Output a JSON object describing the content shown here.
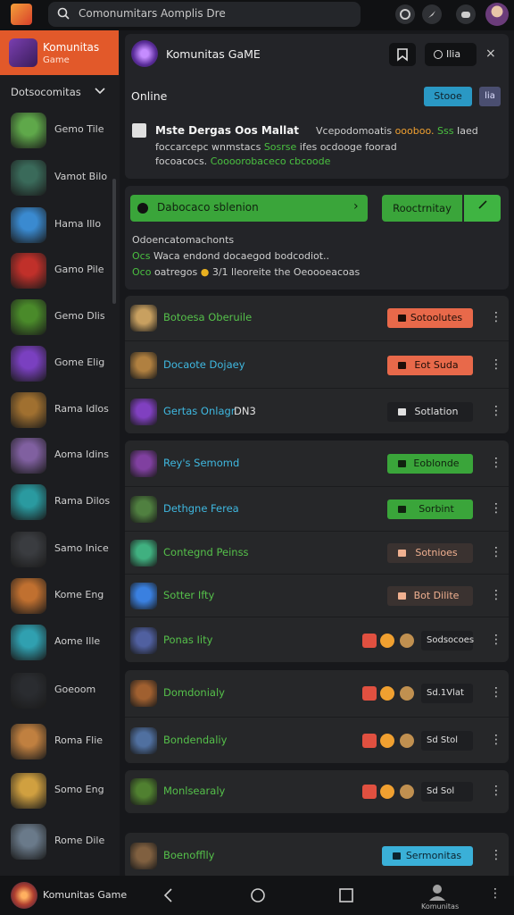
{
  "topbar": {
    "search_value": "Comonumitars Aomplis Dre",
    "icons": [
      "steam-icon",
      "compass-icon",
      "controller-icon"
    ]
  },
  "sidebar": {
    "active": {
      "title": "Komunitas",
      "subtitle": "Game"
    },
    "section_label": "Dotsocomitas",
    "items": [
      {
        "label": "Gemo Tile",
        "color": "#5fa84a"
      },
      {
        "label": "Vamot Bilo",
        "color": "#3a6a5a"
      },
      {
        "label": "Hama Illo",
        "color": "#3a8ad0"
      },
      {
        "label": "Gamo Pile",
        "color": "#c0302a"
      },
      {
        "label": "Gemo Dlis",
        "color": "#4a8a2a"
      },
      {
        "label": "Gome Elig",
        "color": "#7a40c0"
      },
      {
        "label": "Rama Idlos",
        "color": "#a07030"
      },
      {
        "label": "Aoma Idins",
        "color": "#8060a0"
      },
      {
        "label": "Rama Dilos",
        "color": "#2a9aa0"
      },
      {
        "label": "Samo Inice",
        "color": "#3a3c40"
      },
      {
        "label": "Kome Eng",
        "color": "#c07030"
      },
      {
        "label": "Aome Ille",
        "color": "#30a0b0"
      },
      {
        "label": "Goeoom",
        "color": "#2a2c30"
      },
      {
        "label": "Roma Flie",
        "color": "#c08040"
      },
      {
        "label": "Somo Eng",
        "color": "#d0a040"
      },
      {
        "label": "Rome Dile",
        "color": "#6a7a8a"
      }
    ]
  },
  "header": {
    "title": "Komunitas GaME",
    "button_label": "Ilia",
    "close_label": "×",
    "online_label": "Online",
    "tag1": "Stooe",
    "tag2": "lia",
    "desc_bold": "Mste Dergas Oos Mallat",
    "desc_line1_a": "Vcepodomoatis",
    "desc_line1_orange": "oooboo.",
    "desc_line1_green": "Sss",
    "desc_line1_b": "Iaed",
    "desc_line2_a": "foccarcepc wnmstacs",
    "desc_line2_green": "Sosrse",
    "desc_line2_b": "ifes ocdooge foorad",
    "desc_line3_a": "focoacocs.",
    "desc_line3_green": "Coooorobaceco cbcoode"
  },
  "actions": {
    "green_bar_label": "Dabocaco sblenion",
    "primary_button": "Rooctrnitay",
    "sub_label": "Odoencatomachonts",
    "line2_green": "Ocs",
    "line2_text": "Waca endond docaegod bodcodiot..",
    "line3_green": "Oco",
    "line3_a": "oatregos",
    "line3_b": "3/1",
    "line3_c": "lleoreite the",
    "line3_d": "Oeoooeacoas"
  },
  "groups": [
    {
      "rows": [
        {
          "name": "Botoesa Oberuile",
          "name_color": "green",
          "icon_color": "#c8a060",
          "button": "Sotoolutes",
          "button_style": "orange"
        },
        {
          "name": "Docaote Dojaey",
          "name_color": "blue",
          "icon_color": "#b08040",
          "button": "Eot Suda",
          "button_style": "orange"
        },
        {
          "name": "Gertas Onlagr",
          "name_color": "blue",
          "icon_color": "#8040c0",
          "extra": "DN3",
          "button": "Sotlation",
          "button_style": "dark"
        }
      ]
    },
    {
      "rows": [
        {
          "name": "Rey's Semomd",
          "name_color": "blue",
          "icon_color": "#8040a0",
          "button": "Eoblonde",
          "button_style": "green"
        },
        {
          "name": "Dethgne Ferea",
          "name_color": "blue",
          "icon_color": "#508040",
          "button": "Sorbint",
          "button_style": "green"
        },
        {
          "name": "Contegnd Peinss",
          "name_color": "green",
          "icon_color": "#40b080",
          "button": "Sotnioes",
          "button_style": "darko"
        },
        {
          "name": "Sotter Ifty",
          "name_color": "green",
          "icon_color": "#3a80e0",
          "button": "Bot Dilite",
          "button_style": "darko"
        },
        {
          "name": "Ponas Iity",
          "name_color": "green",
          "icon_color": "#5060a0",
          "badge_text": "Sodsocoes"
        }
      ]
    },
    {
      "rows": [
        {
          "name": "Domdonialy",
          "name_color": "green",
          "icon_color": "#a06030",
          "badge_text": "Sd.1Vlat"
        },
        {
          "name": "Bondendaliy",
          "name_color": "green",
          "icon_color": "#5070a0",
          "badge_text": "Sd Stol"
        }
      ]
    },
    {
      "rows": [
        {
          "name": "Monlsearaly",
          "name_color": "green",
          "icon_color": "#508030",
          "badge_text": "Sd Sol"
        }
      ]
    },
    {
      "rows": [
        {
          "name": "Boenofflly",
          "name_color": "green",
          "icon_color": "#806040",
          "button": "Sermonitas",
          "button_style": "blue"
        }
      ]
    }
  ],
  "bottombar": {
    "title": "Komunitas Game",
    "profile_label": "Komunitas"
  }
}
